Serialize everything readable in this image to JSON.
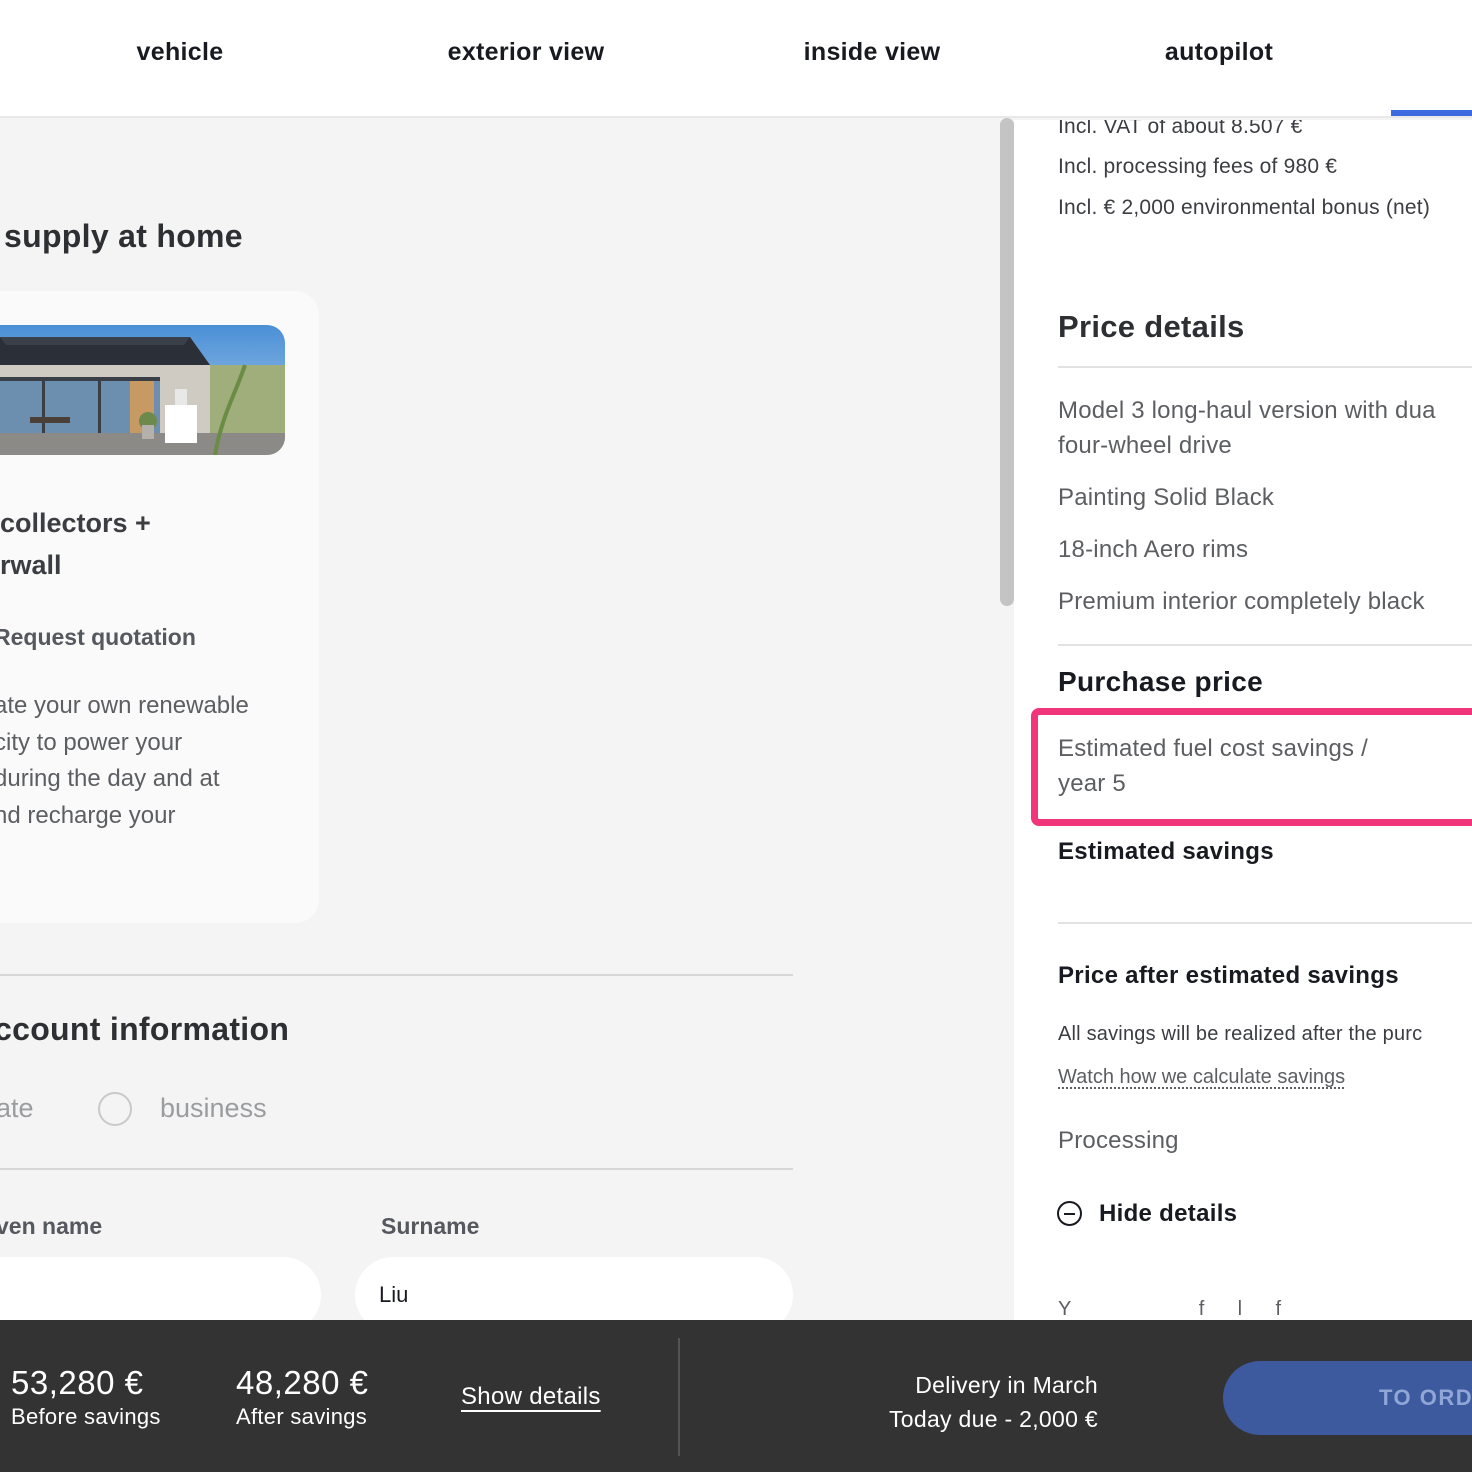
{
  "nav": {
    "tabs": [
      {
        "label": "vehicle"
      },
      {
        "label": "exterior view"
      },
      {
        "label": "inside view"
      },
      {
        "label": "autopilot"
      }
    ]
  },
  "left": {
    "section_title": "supply at home",
    "solar_card": {
      "title": "collectors +\nrwall",
      "quote_link": "Request quotation",
      "description": "ate your own renewable\ncity to power your\nduring the day and at\nnd recharge your\n."
    },
    "account": {
      "title": "ccount information",
      "type_private": "ate",
      "type_business": "business",
      "given_name_label": "ven name",
      "surname_label": "Surname",
      "given_name_value": "",
      "surname_value": "Liu"
    }
  },
  "right": {
    "vat_line": "Incl. VAT of about 8.507 €",
    "fees_line": "Incl. processing fees of 980 €",
    "bonus_line": "Incl. € 2,000 environmental bonus (net)",
    "price_details_title": "Price details",
    "items": [
      "Model 3 long-haul version with dua\nfour-wheel drive",
      "Painting Solid Black",
      "18-inch Aero rims",
      "Premium interior completely black"
    ],
    "purchase_price": "Purchase price",
    "fuel_savings": "Estimated fuel cost savings /\nyear 5",
    "estimated_savings": "Estimated savings",
    "price_after_title": "Price after estimated savings",
    "all_savings_note": "All savings will be realized after the purc",
    "calc_link": "Watch how we calculate savings",
    "processing": "Processing",
    "hide_details": "Hide details",
    "cut_text": "Y                       f      l      f"
  },
  "bottom": {
    "price_before": "53,280 €",
    "label_before": "Before savings",
    "price_after": "48,280 €",
    "label_after": "After savings",
    "show_details": "Show details",
    "delivery": "Delivery in March",
    "today_due": "Today due - 2,000 €",
    "order_button": "TO ORD"
  },
  "colors": {
    "accent": "#3e6ae1",
    "highlight": "#f0357a",
    "bottom_bar": "#333333",
    "order_button": "#3d5a9e"
  }
}
